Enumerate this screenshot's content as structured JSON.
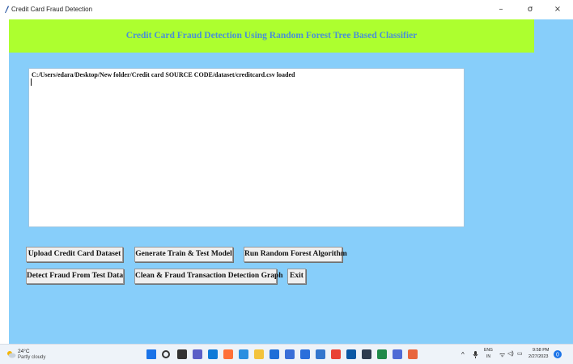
{
  "window": {
    "title": "Credit Card Fraud Detection",
    "controls": {
      "minimize": "–",
      "maximize": "σ",
      "close": "×"
    }
  },
  "header": {
    "title": "Credit Card Fraud Detection Using Random Forest Tree Based Classifier",
    "bg_color": "#adff2f",
    "title_color": "#4a8fd6"
  },
  "app": {
    "bg_color": "#87cefa"
  },
  "output": {
    "text": "C:/Users/edara/Desktop/New folder/Credit card SOURCE CODE/dataset/creditcard.csv loaded"
  },
  "buttons": {
    "upload": "Upload Credit Card Dataset",
    "generate": "Generate Train & Test Model",
    "run_rf": "Run Random Forest Algorithm",
    "detect": "Detect Fraud From Test Data",
    "graph": "Clean & Fraud Transaction Detection Graph",
    "exit": "Exit"
  },
  "taskbar": {
    "weather_temp": "24°C",
    "weather_desc": "Partly cloudy",
    "lang_top": "ENG",
    "lang_bottom": "IN",
    "time": "9:58 PM",
    "date": "2/27/2023",
    "icons": [
      "windows-start-icon",
      "search-icon",
      "task-view-icon",
      "chat-icon",
      "edge-icon",
      "firefox-icon",
      "vscode-icon",
      "file-explorer-icon",
      "store-icon",
      "notepad-icon",
      "mail-icon",
      "photos-icon",
      "chrome-icon",
      "dell-icon",
      "terminal-icon",
      "app-icon-a",
      "app-icon-b",
      "git-icon"
    ]
  }
}
